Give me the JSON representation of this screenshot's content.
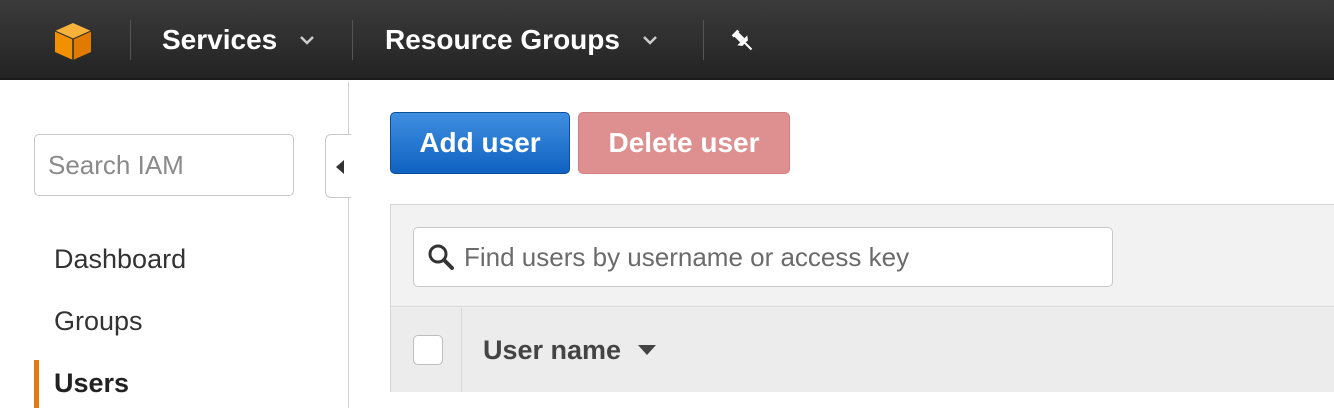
{
  "topnav": {
    "logo_icon": "aws-cube-icon",
    "services_label": "Services",
    "resource_groups_label": "Resource Groups",
    "pin_icon": "pin-icon",
    "brand_color": "#ff9900"
  },
  "sidebar": {
    "search_placeholder": "Search IAM",
    "collapse_icon": "caret-left-icon",
    "items": [
      {
        "label": "Dashboard",
        "active": false
      },
      {
        "label": "Groups",
        "active": false
      },
      {
        "label": "Users",
        "active": true
      }
    ],
    "active_indicator_color": "#e47911"
  },
  "toolbar": {
    "add_user_label": "Add user",
    "delete_user_label": "Delete user",
    "add_color": "#1166bb",
    "delete_color": "#de9090"
  },
  "users_table": {
    "search_placeholder": "Find users by username or access key",
    "search_icon": "search-icon",
    "columns": [
      {
        "label": "User name",
        "sort_icon": "caret-down-icon"
      }
    ]
  }
}
